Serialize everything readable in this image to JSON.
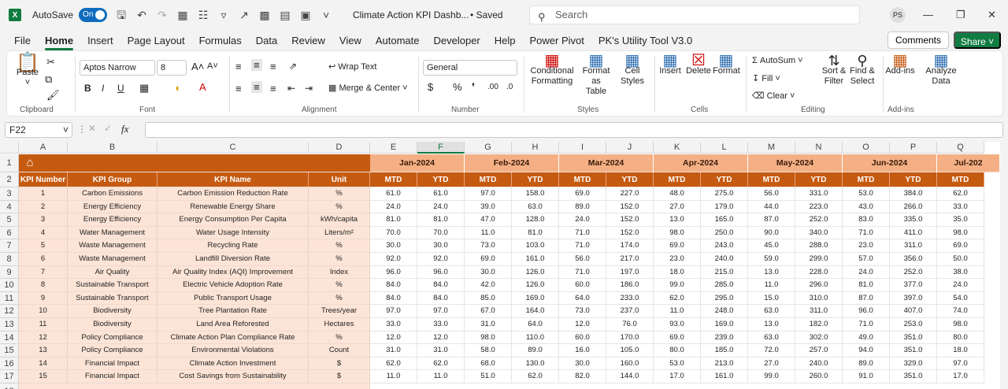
{
  "titlebar": {
    "autosave_label": "AutoSave",
    "autosave_state": "On",
    "doc_title": "Climate Action KPI Dashb...",
    "saved_status": "• Saved",
    "search_placeholder": "Search",
    "user_initials": "PS"
  },
  "menu": [
    "File",
    "Home",
    "Insert",
    "Page Layout",
    "Formulas",
    "Data",
    "Review",
    "View",
    "Automate",
    "Developer",
    "Help",
    "Power Pivot",
    "PK's Utility Tool V3.0"
  ],
  "menu_active": "Home",
  "comments_label": "Comments",
  "share_label": "Share",
  "ribbon": {
    "paste": "Paste",
    "clipboard": "Clipboard",
    "font_name": "Aptos Narrow",
    "font_size": "8",
    "font": "Font",
    "wrap_text": "Wrap Text",
    "merge_center": "Merge & Center",
    "alignment": "Alignment",
    "number_format": "General",
    "number": "Number",
    "conditional_formatting_1": "Conditional",
    "conditional_formatting_2": "Formatting",
    "format_as_table_1": "Format as",
    "format_as_table_2": "Table",
    "cell_styles_1": "Cell",
    "cell_styles_2": "Styles",
    "styles": "Styles",
    "insert": "Insert",
    "delete": "Delete",
    "format": "Format",
    "cells": "Cells",
    "autosum": "AutoSum",
    "fill": "Fill",
    "clear": "Clear",
    "sort_filter_1": "Sort &",
    "sort_filter_2": "Filter",
    "find_select_1": "Find &",
    "find_select_2": "Select",
    "editing": "Editing",
    "addins": "Add-ins",
    "addins_group": "Add-ins",
    "analyze_1": "Analyze",
    "analyze_2": "Data"
  },
  "name_box": "F22",
  "fx_label": "fx",
  "columns": [
    "A",
    "B",
    "C",
    "D",
    "E",
    "F",
    "G",
    "H",
    "I",
    "J",
    "K",
    "L",
    "M",
    "N",
    "O",
    "P",
    "Q"
  ],
  "row_numbers": [
    "1",
    "2",
    "3",
    "4",
    "5",
    "6",
    "7",
    "8",
    "9",
    "10",
    "11",
    "12",
    "13",
    "14",
    "15",
    "16",
    "17",
    "18"
  ],
  "months": [
    "Jan-2024",
    "Feb-2024",
    "Mar-2024",
    "Apr-2024",
    "May-2024",
    "Jun-2024",
    "Jul-202"
  ],
  "headers": {
    "kpi_number": "KPI Number",
    "kpi_group": "KPI Group",
    "kpi_name": "KPI Name",
    "unit": "Unit",
    "mtd": "MTD",
    "ytd": "YTD"
  },
  "rows": [
    {
      "n": "1",
      "group": "Carbon Emissions",
      "name": "Carbon Emission Reduction Rate",
      "unit": "%",
      "v": [
        "61.0",
        "61.0",
        "97.0",
        "158.0",
        "69.0",
        "227.0",
        "48.0",
        "275.0",
        "56.0",
        "331.0",
        "53.0",
        "384.0",
        "62.0"
      ]
    },
    {
      "n": "2",
      "group": "Energy Efficiency",
      "name": "Renewable Energy Share",
      "unit": "%",
      "v": [
        "24.0",
        "24.0",
        "39.0",
        "63.0",
        "89.0",
        "152.0",
        "27.0",
        "179.0",
        "44.0",
        "223.0",
        "43.0",
        "266.0",
        "33.0"
      ]
    },
    {
      "n": "3",
      "group": "Energy Efficiency",
      "name": "Energy Consumption Per Capita",
      "unit": "kWh/capita",
      "v": [
        "81.0",
        "81.0",
        "47.0",
        "128.0",
        "24.0",
        "152.0",
        "13.0",
        "165.0",
        "87.0",
        "252.0",
        "83.0",
        "335.0",
        "35.0"
      ]
    },
    {
      "n": "4",
      "group": "Water Management",
      "name": "Water Usage Intensity",
      "unit": "Liters/m²",
      "v": [
        "70.0",
        "70.0",
        "11.0",
        "81.0",
        "71.0",
        "152.0",
        "98.0",
        "250.0",
        "90.0",
        "340.0",
        "71.0",
        "411.0",
        "98.0"
      ]
    },
    {
      "n": "5",
      "group": "Waste Management",
      "name": "Recycling Rate",
      "unit": "%",
      "v": [
        "30.0",
        "30.0",
        "73.0",
        "103.0",
        "71.0",
        "174.0",
        "69.0",
        "243.0",
        "45.0",
        "288.0",
        "23.0",
        "311.0",
        "69.0"
      ]
    },
    {
      "n": "6",
      "group": "Waste Management",
      "name": "Landfill Diversion Rate",
      "unit": "%",
      "v": [
        "92.0",
        "92.0",
        "69.0",
        "161.0",
        "56.0",
        "217.0",
        "23.0",
        "240.0",
        "59.0",
        "299.0",
        "57.0",
        "356.0",
        "50.0"
      ]
    },
    {
      "n": "7",
      "group": "Air Quality",
      "name": "Air Quality Index (AQI) Improvement",
      "unit": "Index",
      "v": [
        "96.0",
        "96.0",
        "30.0",
        "126.0",
        "71.0",
        "197.0",
        "18.0",
        "215.0",
        "13.0",
        "228.0",
        "24.0",
        "252.0",
        "38.0"
      ]
    },
    {
      "n": "8",
      "group": "Sustainable Transport",
      "name": "Electric Vehicle Adoption Rate",
      "unit": "%",
      "v": [
        "84.0",
        "84.0",
        "42.0",
        "126.0",
        "60.0",
        "186.0",
        "99.0",
        "285.0",
        "11.0",
        "296.0",
        "81.0",
        "377.0",
        "24.0"
      ]
    },
    {
      "n": "9",
      "group": "Sustainable Transport",
      "name": "Public Transport Usage",
      "unit": "%",
      "v": [
        "84.0",
        "84.0",
        "85.0",
        "169.0",
        "64.0",
        "233.0",
        "62.0",
        "295.0",
        "15.0",
        "310.0",
        "87.0",
        "397.0",
        "54.0"
      ]
    },
    {
      "n": "10",
      "group": "Biodiversity",
      "name": "Tree Plantation Rate",
      "unit": "Trees/year",
      "v": [
        "97.0",
        "97.0",
        "67.0",
        "164.0",
        "73.0",
        "237.0",
        "11.0",
        "248.0",
        "63.0",
        "311.0",
        "96.0",
        "407.0",
        "74.0"
      ]
    },
    {
      "n": "11",
      "group": "Biodiversity",
      "name": "Land Area Reforested",
      "unit": "Hectares",
      "v": [
        "33.0",
        "33.0",
        "31.0",
        "64.0",
        "12.0",
        "76.0",
        "93.0",
        "169.0",
        "13.0",
        "182.0",
        "71.0",
        "253.0",
        "98.0"
      ]
    },
    {
      "n": "12",
      "group": "Policy Compliance",
      "name": "Climate Action Plan Compliance Rate",
      "unit": "%",
      "v": [
        "12.0",
        "12.0",
        "98.0",
        "110.0",
        "60.0",
        "170.0",
        "69.0",
        "239.0",
        "63.0",
        "302.0",
        "49.0",
        "351.0",
        "80.0"
      ]
    },
    {
      "n": "13",
      "group": "Policy Compliance",
      "name": "Environmental Violations",
      "unit": "Count",
      "v": [
        "31.0",
        "31.0",
        "58.0",
        "89.0",
        "16.0",
        "105.0",
        "80.0",
        "185.0",
        "72.0",
        "257.0",
        "94.0",
        "351.0",
        "18.0"
      ]
    },
    {
      "n": "14",
      "group": "Financial Impact",
      "name": "Climate Action Investment",
      "unit": "$",
      "v": [
        "62.0",
        "62.0",
        "68.0",
        "130.0",
        "30.0",
        "160.0",
        "53.0",
        "213.0",
        "27.0",
        "240.0",
        "89.0",
        "329.0",
        "97.0"
      ]
    },
    {
      "n": "15",
      "group": "Financial Impact",
      "name": "Cost Savings from Sustainability",
      "unit": "$",
      "v": [
        "11.0",
        "11.0",
        "51.0",
        "62.0",
        "82.0",
        "144.0",
        "17.0",
        "161.0",
        "99.0",
        "260.0",
        "91.0",
        "351.0",
        "17.0"
      ]
    }
  ],
  "colors": {
    "header_dark": "#c55a11",
    "header_light": "#f4b084",
    "row_tint": "#fce4d6",
    "accent": "#107c41"
  }
}
